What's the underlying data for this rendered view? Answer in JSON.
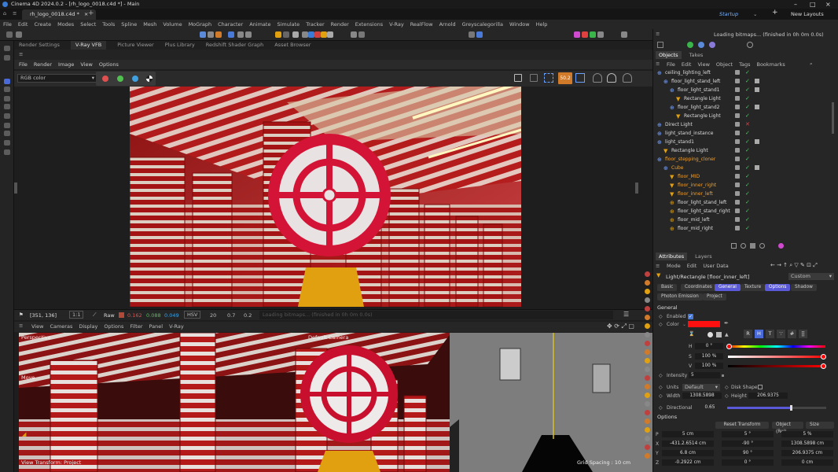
{
  "window": {
    "title": "Cinema 4D 2024.0.2 - [rh_logo_0018.c4d *] - Main",
    "doc_tab": "rh_logo_0018.c4d *",
    "layout_label": "Startup",
    "new_layouts": "New Layouts"
  },
  "menu": [
    "File",
    "Edit",
    "Create",
    "Modes",
    "Select",
    "Tools",
    "Spline",
    "Mesh",
    "Volume",
    "MoGraph",
    "Character",
    "Animate",
    "Simulate",
    "Tracker",
    "Render",
    "Extensions",
    "V-Ray",
    "RealFlow",
    "Arnold",
    "Greyscalegorilla",
    "Window",
    "Help"
  ],
  "panel_tabs": [
    "Render Settings",
    "V-Ray VFB",
    "Picture Viewer",
    "Plus Library",
    "Redshift Shader Graph",
    "Asset Browser"
  ],
  "vfb": {
    "menu": [
      "File",
      "Render",
      "Image",
      "View",
      "Options"
    ],
    "channel": "RGB color",
    "badge": "50.2",
    "coords": "[351, 136]",
    "ratio": "1:1",
    "mode": "Raw",
    "r": "0.162",
    "g": "0.088",
    "b": "0.049",
    "colorspace": "HSV",
    "v1": "20",
    "v2": "0.7",
    "v3": "0.2",
    "status": "Loading bitmaps... (finished in 0h 0m 0.0s)",
    "colors": {
      "r": "#e05050",
      "g": "#50c050",
      "b": "#40a0e0"
    }
  },
  "viewport": {
    "menu": [
      "View",
      "Cameras",
      "Display",
      "Options",
      "Filter",
      "Panel",
      "V-Ray"
    ],
    "label": "Perspective",
    "camera": "Default Camera",
    "move": "Move",
    "transform": "View Transform: Project",
    "grid": "Grid Spacing : 10 cm"
  },
  "right": {
    "loading": "Loading bitmaps... (finished in 0h 0m 0.0s)",
    "tabs": [
      "Objects",
      "Takes"
    ],
    "menu": [
      "File",
      "Edit",
      "View",
      "Object",
      "Tags",
      "Bookmarks"
    ],
    "objects": [
      {
        "name": "ceiling_lighting_left",
        "indent": 0,
        "hl": false
      },
      {
        "name": "floor_light_stand_left",
        "indent": 1,
        "hl": false
      },
      {
        "name": "floor_light_stand1",
        "indent": 2,
        "hl": false
      },
      {
        "name": "Rectangle Light",
        "indent": 3,
        "hl": false
      },
      {
        "name": "floor_light_stand2",
        "indent": 2,
        "hl": false
      },
      {
        "name": "Rectangle Light",
        "indent": 3,
        "hl": false
      },
      {
        "name": "Direct Light",
        "indent": 0,
        "hl": false
      },
      {
        "name": "light_stand_instance",
        "indent": 0,
        "hl": false
      },
      {
        "name": "light_stand1",
        "indent": 0,
        "hl": false
      },
      {
        "name": "Rectangle Light",
        "indent": 1,
        "hl": false
      },
      {
        "name": "floor_stepping_cloner",
        "indent": 0,
        "hl": true
      },
      {
        "name": "Cube",
        "indent": 1,
        "hl": true
      },
      {
        "name": "floor_MID",
        "indent": 2,
        "hl": true
      },
      {
        "name": "floor_inner_right",
        "indent": 2,
        "hl": true
      },
      {
        "name": "floor_inner_left",
        "indent": 2,
        "hl": true
      },
      {
        "name": "floor_light_stand_left",
        "indent": 2,
        "hl": false
      },
      {
        "name": "floor_light_stand_right",
        "indent": 2,
        "hl": false
      },
      {
        "name": "floor_mid_left",
        "indent": 2,
        "hl": false
      },
      {
        "name": "floor_mid_right",
        "indent": 2,
        "hl": false
      }
    ],
    "attr_tabs": [
      "Attributes",
      "Layers"
    ],
    "attr_menu": [
      "Mode",
      "Edit",
      "User Data"
    ],
    "object_label": "Light/Rectangle [floor_inner_left]",
    "preset": "Custom",
    "sub_tabs": [
      "Basic",
      "Coordinates",
      "General",
      "Texture",
      "Options",
      "Shadow"
    ],
    "sub_tabs2": [
      "Photon Emission",
      "Project"
    ],
    "general": "General",
    "enabled": "Enabled",
    "color": "Color",
    "h_label": "H",
    "h_val": "0 °",
    "s_label": "S",
    "s_val": "100 %",
    "v_label": "V",
    "v_val": "100 %",
    "intensity_label": "Intensity",
    "intensity": "5",
    "units_label": "Units",
    "units": "Default",
    "disk_shape": "Disk Shape",
    "width_label": "Width",
    "width": "1308.5898",
    "height_label": "Height",
    "height": "206.9375",
    "directional_label": "Directional",
    "directional": "0.65",
    "options": "Options",
    "reset_transform": "Reset Transform",
    "object_rel": "Object (Rel)",
    "size_label": "Size",
    "transform_rows": [
      {
        "k": "P",
        "a": "5 cm",
        "b": "5 °",
        "c": "5 %"
      },
      {
        "k": "X",
        "a": "-431.2.6514 cm",
        "b": "-90 °",
        "c": "1308.5898 cm"
      },
      {
        "k": "Y",
        "a": "6.8 cm",
        "b": "90 °",
        "c": "206.9375 cm"
      },
      {
        "k": "Z",
        "a": "-0.2922 cm",
        "b": "0 °",
        "c": "0 cm"
      }
    ],
    "colors": {
      "light": "#ff1010",
      "accent": "#5a5ad8"
    }
  }
}
